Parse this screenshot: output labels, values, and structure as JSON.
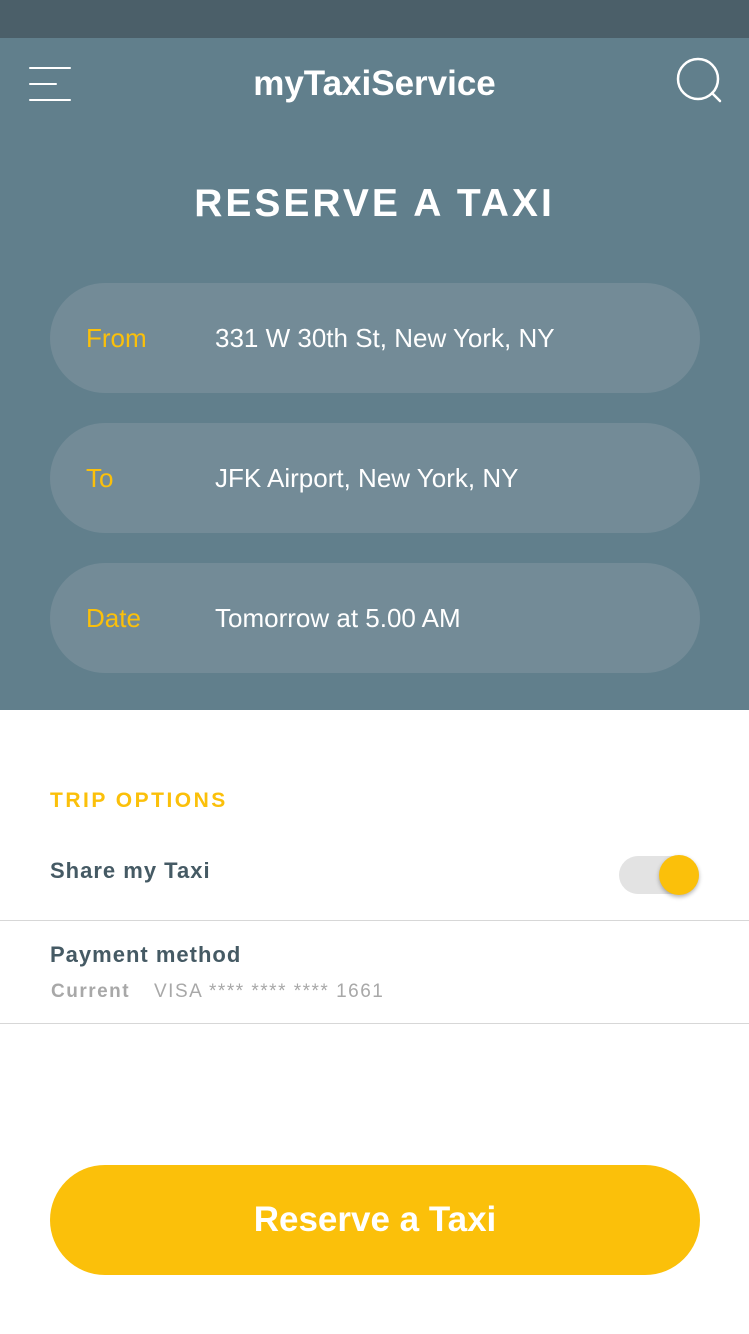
{
  "header": {
    "app_title": "myTaxiService",
    "menu_icon": "hamburger-menu-icon",
    "search_icon": "search-icon"
  },
  "page_title": "RESERVE A TAXI",
  "form": {
    "from": {
      "label": "From",
      "value": "331 W 30th St, New York, NY"
    },
    "to": {
      "label": "To",
      "value": "JFK Airport, New York, NY"
    },
    "date": {
      "label": "Date",
      "value": "Tomorrow at 5.00 AM"
    }
  },
  "trip_options": {
    "title": "TRIP OPTIONS",
    "share": {
      "label": "Share my Taxi",
      "enabled": true
    },
    "payment": {
      "label": "Payment method",
      "current_label": "Current",
      "card": "VISA **** **** **** 1661"
    }
  },
  "submit_label": "Reserve a Taxi",
  "colors": {
    "status_bar": "#4b5f69",
    "hero": "#617f8c",
    "field": "#738b97",
    "accent": "#fbc00a",
    "text_dark": "#455a64",
    "text_muted": "#a8a8a8"
  }
}
